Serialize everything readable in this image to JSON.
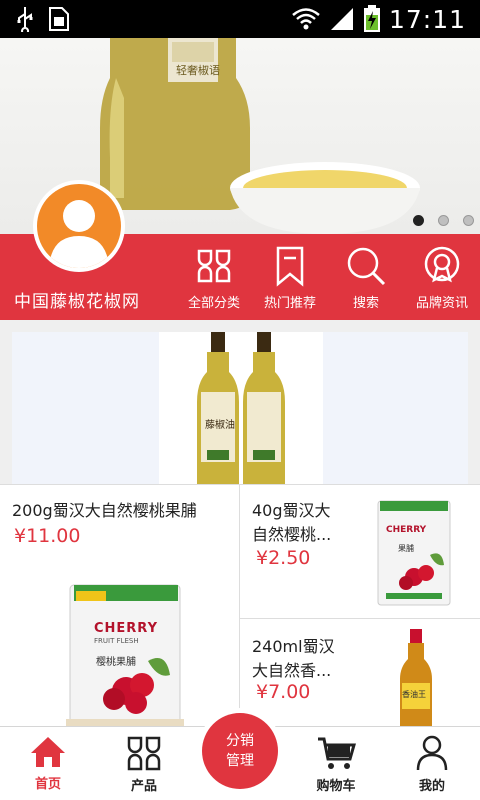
{
  "status_bar": {
    "time": "17:11",
    "icons": [
      "usb-icon",
      "sim-card-icon",
      "wifi-icon",
      "signal-icon",
      "battery-charging-icon"
    ]
  },
  "banner": {
    "slides": 3,
    "active_slide": 1,
    "label_text": "轻奢椒语"
  },
  "header": {
    "site_name": "中国藤椒花椒网",
    "nav": [
      {
        "label": "全部分类",
        "icon": "grid-icon"
      },
      {
        "label": "热门推荐",
        "icon": "bookmark-icon"
      },
      {
        "label": "搜索",
        "icon": "search-icon"
      },
      {
        "label": "品牌资讯",
        "icon": "badge-icon"
      }
    ]
  },
  "products": {
    "featured": {
      "bottle_label": "藤椒油"
    },
    "left": {
      "title": "200g蜀汉大自然樱桃果脯",
      "price": "¥11.00",
      "pack_brand": "CHERRY",
      "pack_sub": "FRUIT FLESH",
      "pack_cn": "樱桃果脯"
    },
    "right_top": {
      "title_line1": "40g蜀汉大",
      "title_line2": "自然樱桃...",
      "price": "¥2.50",
      "pack_brand": "CHERRY",
      "pack_cn": "果脯"
    },
    "right_bottom": {
      "title_line1": "240ml蜀汉",
      "title_line2": "大自然香...",
      "price": "¥7.00",
      "bottle_label": "香油王"
    }
  },
  "tabbar": {
    "items": [
      {
        "label": "首页",
        "icon": "home-icon",
        "active": true
      },
      {
        "label": "产品",
        "icon": "grid-icon",
        "active": false
      },
      {
        "label": "购物车",
        "icon": "cart-icon",
        "active": false
      },
      {
        "label": "我的",
        "icon": "user-icon",
        "active": false
      }
    ],
    "center_line1": "分销",
    "center_line2": "管理"
  },
  "colors": {
    "accent": "#e0353f",
    "avatar": "#f28a28"
  }
}
